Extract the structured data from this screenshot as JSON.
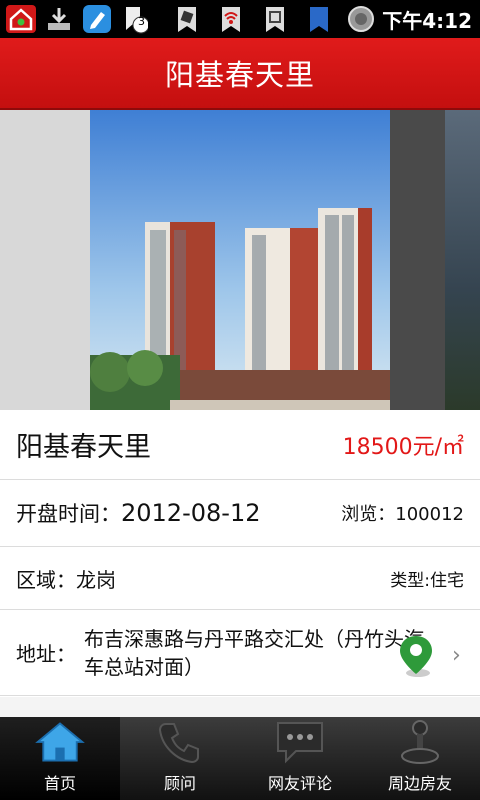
{
  "status_bar": {
    "time": "下午4:12",
    "notification_count": "3",
    "icons": [
      "house-heart-icon",
      "download-icon",
      "pencil-icon",
      "notification-icon",
      "sync-icon",
      "wifi-icon",
      "signal-icon",
      "bookmark-icon",
      "battery-icon"
    ]
  },
  "header": {
    "title": "阳基春天里"
  },
  "property": {
    "name": "阳基春天里",
    "price": "18500元/㎡",
    "date_label": "开盘时间：",
    "date_value": "2012-08-12",
    "views": "浏览：100012",
    "area": "区域：龙岗",
    "type": "类型:住宅",
    "address_label": "地址：",
    "address": "布吉深惠路与丹平路交汇处（丹竹头汽车总站对面）"
  },
  "tabs": [
    {
      "label": "首页",
      "icon": "home-icon",
      "active": true
    },
    {
      "label": "顾问",
      "icon": "phone-icon",
      "active": false
    },
    {
      "label": "网友评论",
      "icon": "chat-bubble-icon",
      "active": false
    },
    {
      "label": "周边房友",
      "icon": "joystick-icon",
      "active": false
    }
  ],
  "colors": {
    "brand_red": "#d41414",
    "price_red": "#e21818",
    "map_pin_green": "#2e9a3a"
  }
}
